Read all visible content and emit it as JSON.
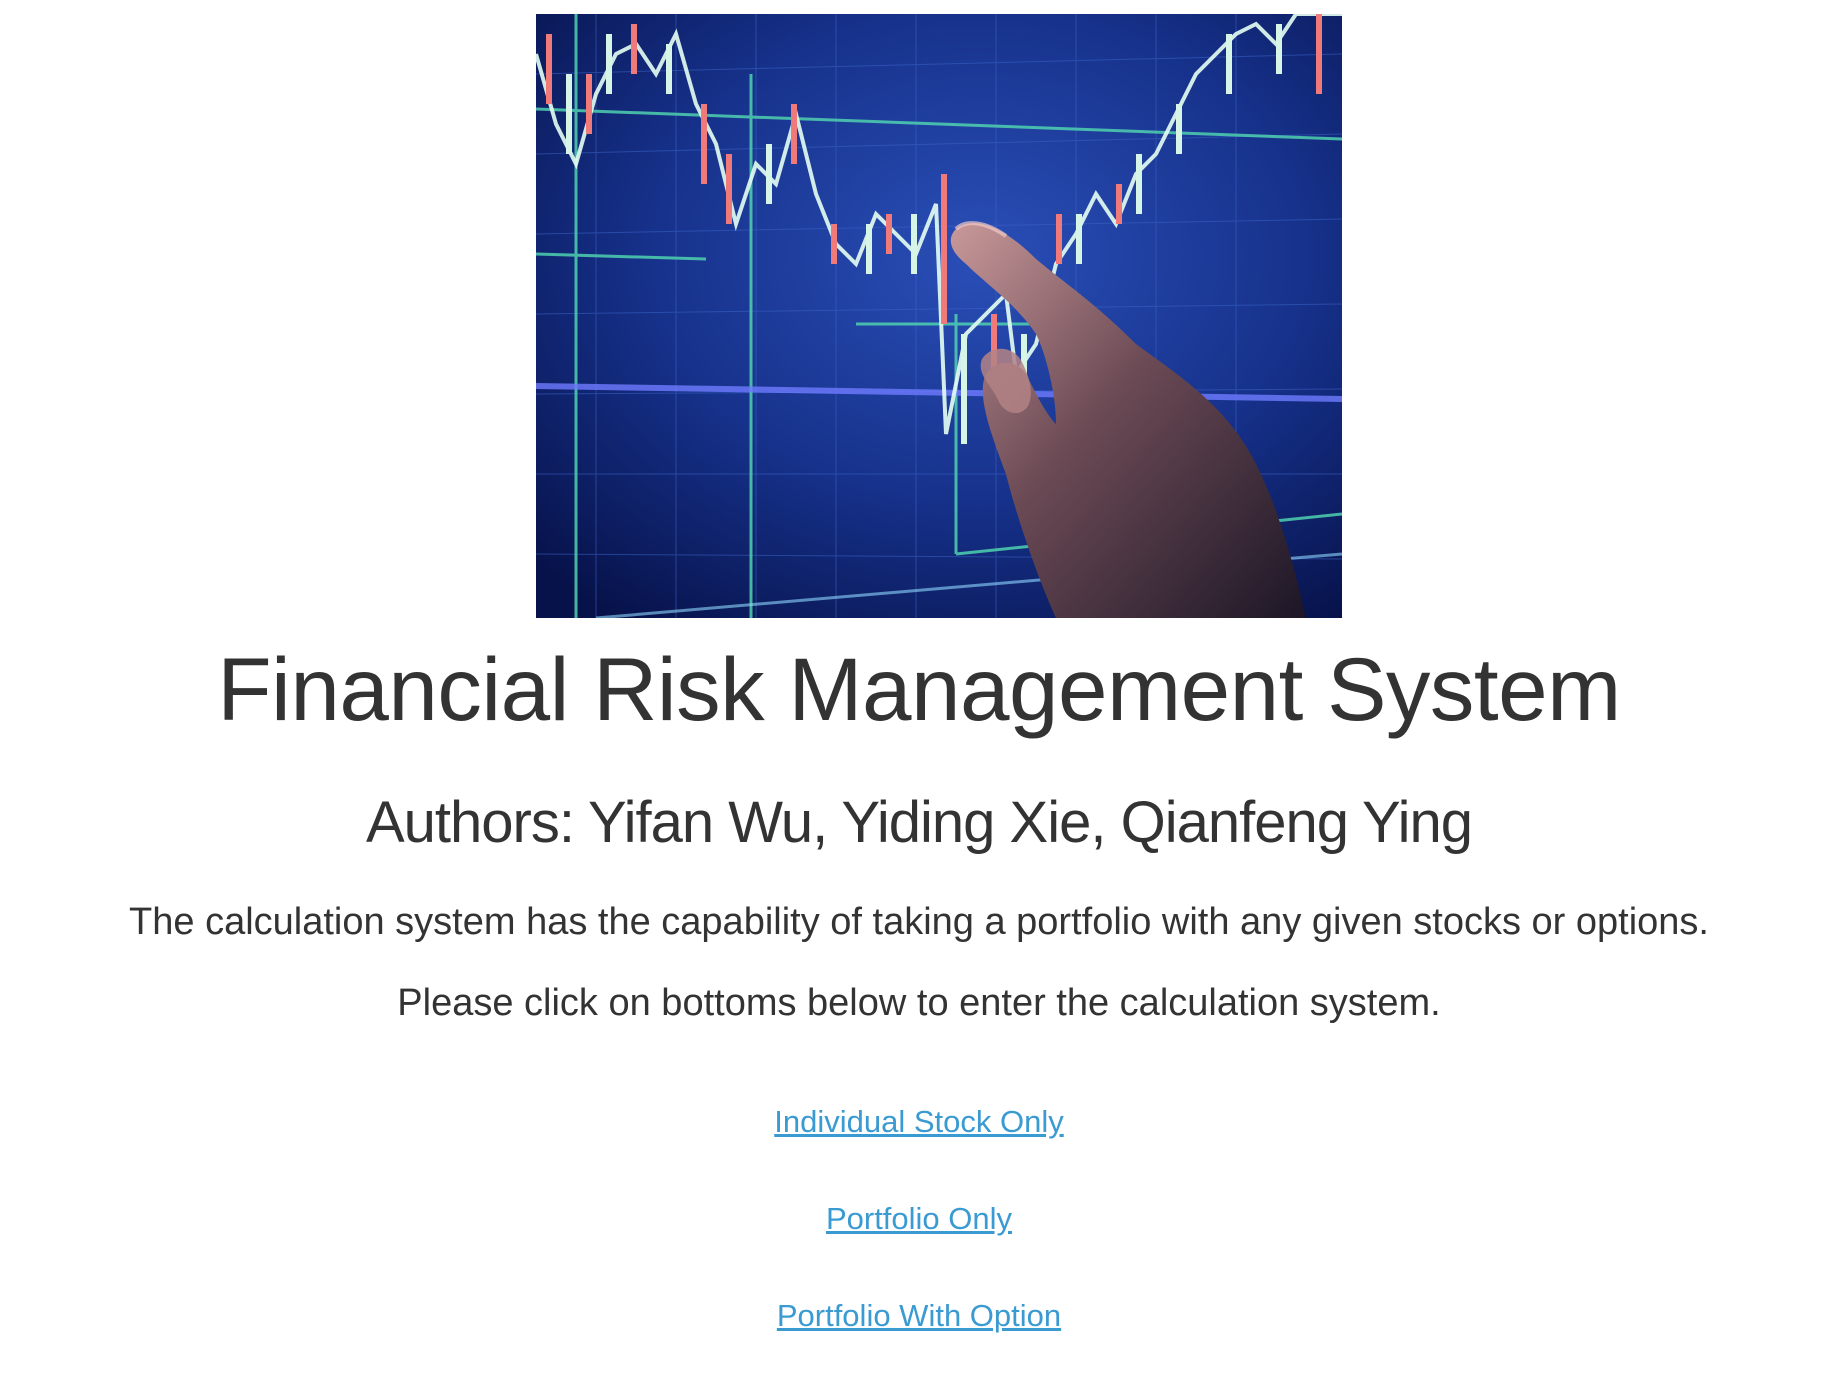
{
  "hero_image": {
    "icon": "stock-chart-hand-image",
    "colors": {
      "background": "#0b1d5a",
      "grid": "#4fd1b0",
      "candle_up": "#d6f5e6",
      "candle_down": "#f07a7a"
    }
  },
  "header": {
    "title": "Financial Risk Management System",
    "authors": "Authors: Yifan Wu, Yiding Xie, Qianfeng Ying"
  },
  "intro": {
    "line1": "The calculation system has the capability of taking a portfolio with any given stocks or options.",
    "line2": "Please click on bottoms below to enter the calculation system."
  },
  "links": {
    "individual_stock": "Individual Stock Only",
    "portfolio_only": "Portfolio Only",
    "portfolio_with_option": "Portfolio With Option"
  },
  "colors": {
    "text": "#333333",
    "link": "#3a9ad2"
  }
}
